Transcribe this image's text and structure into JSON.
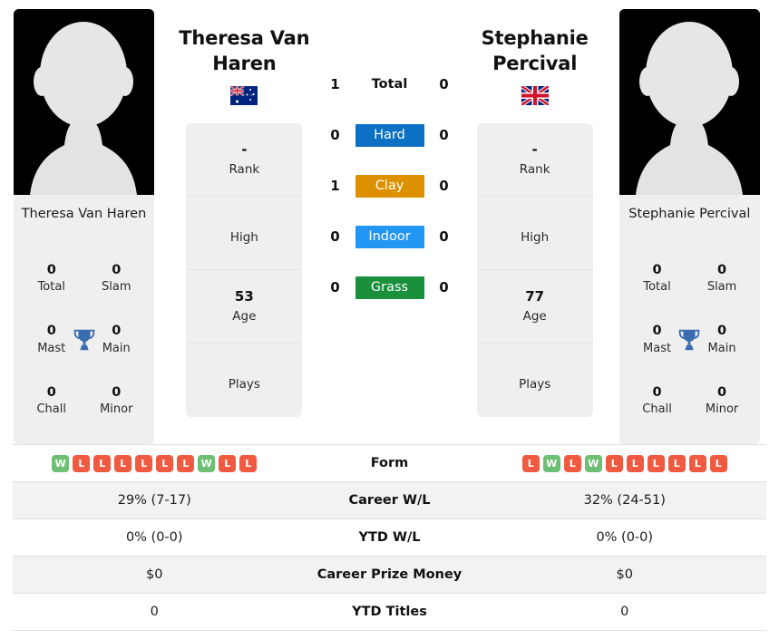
{
  "players": {
    "left": {
      "name": "Theresa Van Haren",
      "card_name": "Theresa Van Haren",
      "flag": "australia-flag",
      "rank_value": "-",
      "rank_label": "Rank",
      "high_value": "",
      "high_label": "High",
      "age_value": "53",
      "age_label": "Age",
      "plays_value": "",
      "plays_label": "Plays",
      "titles": {
        "total_value": "0",
        "total_label": "Total",
        "slam_value": "0",
        "slam_label": "Slam",
        "mast_value": "0",
        "mast_label": "Mast",
        "main_value": "0",
        "main_label": "Main",
        "chall_value": "0",
        "chall_label": "Chall",
        "minor_value": "0",
        "minor_label": "Minor"
      },
      "form": [
        "W",
        "L",
        "L",
        "L",
        "L",
        "L",
        "L",
        "W",
        "L",
        "L"
      ],
      "career_wl": "29% (7-17)",
      "ytd_wl": "0% (0-0)",
      "career_prize_money": "$0",
      "ytd_titles": "0"
    },
    "right": {
      "name": "Stephanie Percival",
      "card_name": "Stephanie Percival",
      "flag": "uk-flag",
      "rank_value": "-",
      "rank_label": "Rank",
      "high_value": "",
      "high_label": "High",
      "age_value": "77",
      "age_label": "Age",
      "plays_value": "",
      "plays_label": "Plays",
      "titles": {
        "total_value": "0",
        "total_label": "Total",
        "slam_value": "0",
        "slam_label": "Slam",
        "mast_value": "0",
        "mast_label": "Mast",
        "main_value": "0",
        "main_label": "Main",
        "chall_value": "0",
        "chall_label": "Chall",
        "minor_value": "0",
        "minor_label": "Minor"
      },
      "form": [
        "L",
        "W",
        "L",
        "W",
        "L",
        "L",
        "L",
        "L",
        "L",
        "L"
      ],
      "career_wl": "32% (24-51)",
      "ytd_wl": "0% (0-0)",
      "career_prize_money": "$0",
      "ytd_titles": "0"
    }
  },
  "head_to_head": {
    "rows": [
      {
        "label": "Total",
        "left": "1",
        "right": "0",
        "style": "plain",
        "color": ""
      },
      {
        "label": "Hard",
        "left": "0",
        "right": "0",
        "style": "badge",
        "color": "#0c70c4"
      },
      {
        "label": "Clay",
        "left": "1",
        "right": "0",
        "style": "badge",
        "color": "#dd9000"
      },
      {
        "label": "Indoor",
        "left": "0",
        "right": "0",
        "style": "badge",
        "color": "#2196f3"
      },
      {
        "label": "Grass",
        "left": "0",
        "right": "0",
        "style": "badge",
        "color": "#1a8f3c"
      }
    ]
  },
  "stats_table": {
    "rows": [
      {
        "label": "Form",
        "type": "form"
      },
      {
        "label": "Career W/L",
        "type": "text",
        "left": "29% (7-17)",
        "right": "32% (24-51)"
      },
      {
        "label": "YTD W/L",
        "type": "text",
        "left": "0% (0-0)",
        "right": "0% (0-0)"
      },
      {
        "label": "Career Prize Money",
        "type": "text",
        "left": "$0",
        "right": "$0"
      },
      {
        "label": "YTD Titles",
        "type": "text",
        "left": "0",
        "right": "0"
      }
    ]
  },
  "colors": {
    "hard": "#0c70c4",
    "clay": "#dd9000",
    "indoor": "#2196f3",
    "grass": "#1a8f3c",
    "win": "#6cbf73",
    "loss": "#f05a40",
    "trophy": "#3b6cb0",
    "card_bg": "#efefef",
    "alt_row": "#f2f2f2"
  }
}
